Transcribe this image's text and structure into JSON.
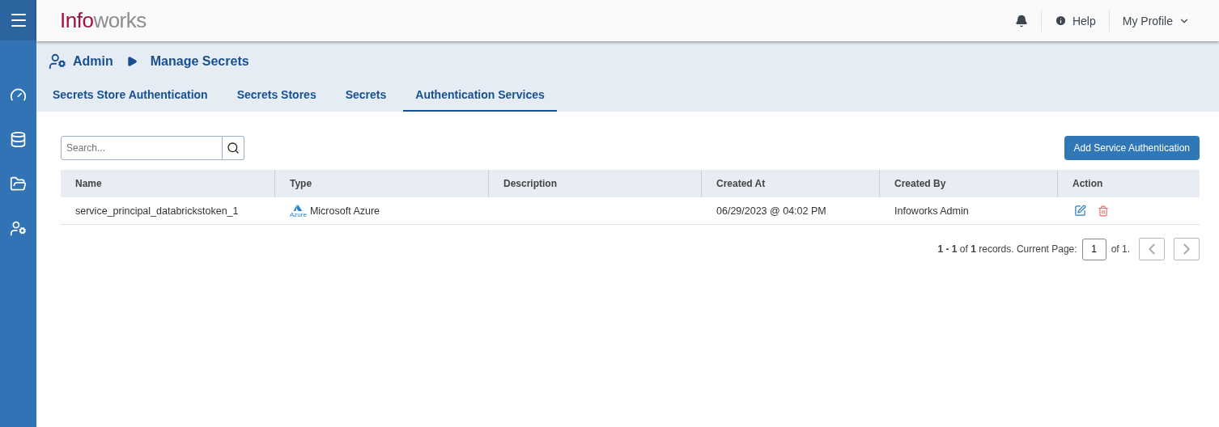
{
  "header": {
    "logo": {
      "first": "Info",
      "second": "works"
    },
    "help": "Help",
    "profile": "My Profile"
  },
  "sidebar": {
    "items": [
      {
        "kind": "dashboard",
        "selected": false
      },
      {
        "kind": "database",
        "selected": false
      },
      {
        "kind": "folder",
        "selected": false
      },
      {
        "kind": "admin",
        "selected": false
      }
    ]
  },
  "breadcrumb": [
    "Admin",
    "Manage Secrets"
  ],
  "tabs": [
    {
      "label": "Secrets Store Authentication",
      "selected": false
    },
    {
      "label": "Secrets Stores",
      "selected": false
    },
    {
      "label": "Secrets",
      "selected": false
    },
    {
      "label": "Authentication Services",
      "selected": true
    }
  ],
  "search": {
    "placeholder": "Search..."
  },
  "add_button": "Add Service Authentication",
  "table": {
    "columns": [
      "Name",
      "Type",
      "Description",
      "Created At",
      "Created By",
      "Action"
    ],
    "rows": [
      {
        "name": "service_principal_databrickstoken_1",
        "type": "Microsoft Azure",
        "type_badge": "Azure",
        "created_at": "06/29/2023 @ 04:02 PM",
        "created_by": "Infoworks Admin"
      }
    ]
  },
  "pagination": {
    "summary": "**1 - 1** of **1** records. Current Page:",
    "page": "1",
    "of": "of 1."
  }
}
